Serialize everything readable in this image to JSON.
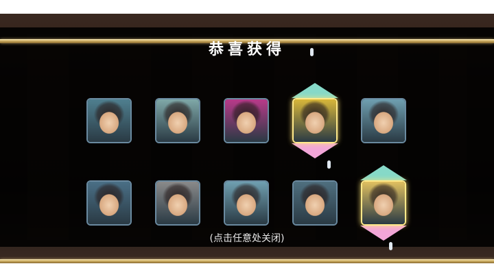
{
  "dialog": {
    "title": "恭喜获得",
    "hint": "(点击任意处关闭)"
  },
  "rewards": [
    {
      "name": "bearded-warrior-portrait",
      "rare": false,
      "bg": "#4f7f8f"
    },
    {
      "name": "silver-haired-elder-portrait",
      "rare": false,
      "bg": "#7fa8a8"
    },
    {
      "name": "twin-bun-girl-portrait",
      "rare": false,
      "bg": "#b83a8a"
    },
    {
      "name": "grey-haired-swordsman-portrait",
      "rare": true,
      "bg": "#d8b73a"
    },
    {
      "name": "bald-monk-portrait",
      "rare": false,
      "bg": "#6f9fb0"
    },
    {
      "name": "dark-haired-woman-portrait",
      "rare": false,
      "bg": "#4a6f86"
    },
    {
      "name": "hooded-figure-portrait",
      "rare": false,
      "bg": "#8a8a8a"
    },
    {
      "name": "bald-monk-portrait-2",
      "rare": false,
      "bg": "#6f9fb0"
    },
    {
      "name": "long-haired-warrior-portrait",
      "rare": false,
      "bg": "#4f6f7f"
    },
    {
      "name": "blonde-girl-portrait",
      "rare": true,
      "bg": "#e0c060"
    }
  ]
}
